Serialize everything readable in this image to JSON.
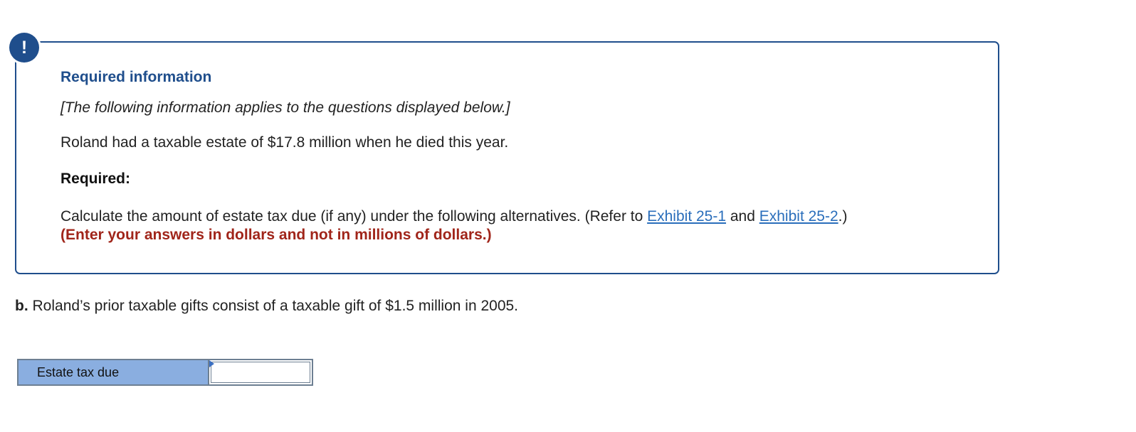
{
  "alert": {
    "icon": "exclamation-icon",
    "symbol": "!",
    "color": "#1f4e8c"
  },
  "info": {
    "heading": "Required information",
    "intro": "[The following information applies to the questions displayed below.]",
    "statement": "Roland had a taxable estate of $17.8 million when he died this year.",
    "required_label": "Required:",
    "instructions_before": "Calculate the amount of estate tax due (if any) under the following alternatives. (Refer to ",
    "link1": "Exhibit 25-1",
    "instructions_mid": " and ",
    "link2": "Exhibit 25-2",
    "instructions_after": ".)",
    "warning": "(Enter your answers in dollars and not in millions of dollars.)"
  },
  "part_b": {
    "label": "b.",
    "text": " Roland’s prior taxable gifts consist of a taxable gift of $1.5 million in 2005."
  },
  "answer": {
    "label": "Estate tax due",
    "value": ""
  },
  "colors": {
    "accent": "#1f4e8c",
    "link": "#2a6ebb",
    "warning": "#a0251a",
    "label_bg": "#8aaee0"
  }
}
